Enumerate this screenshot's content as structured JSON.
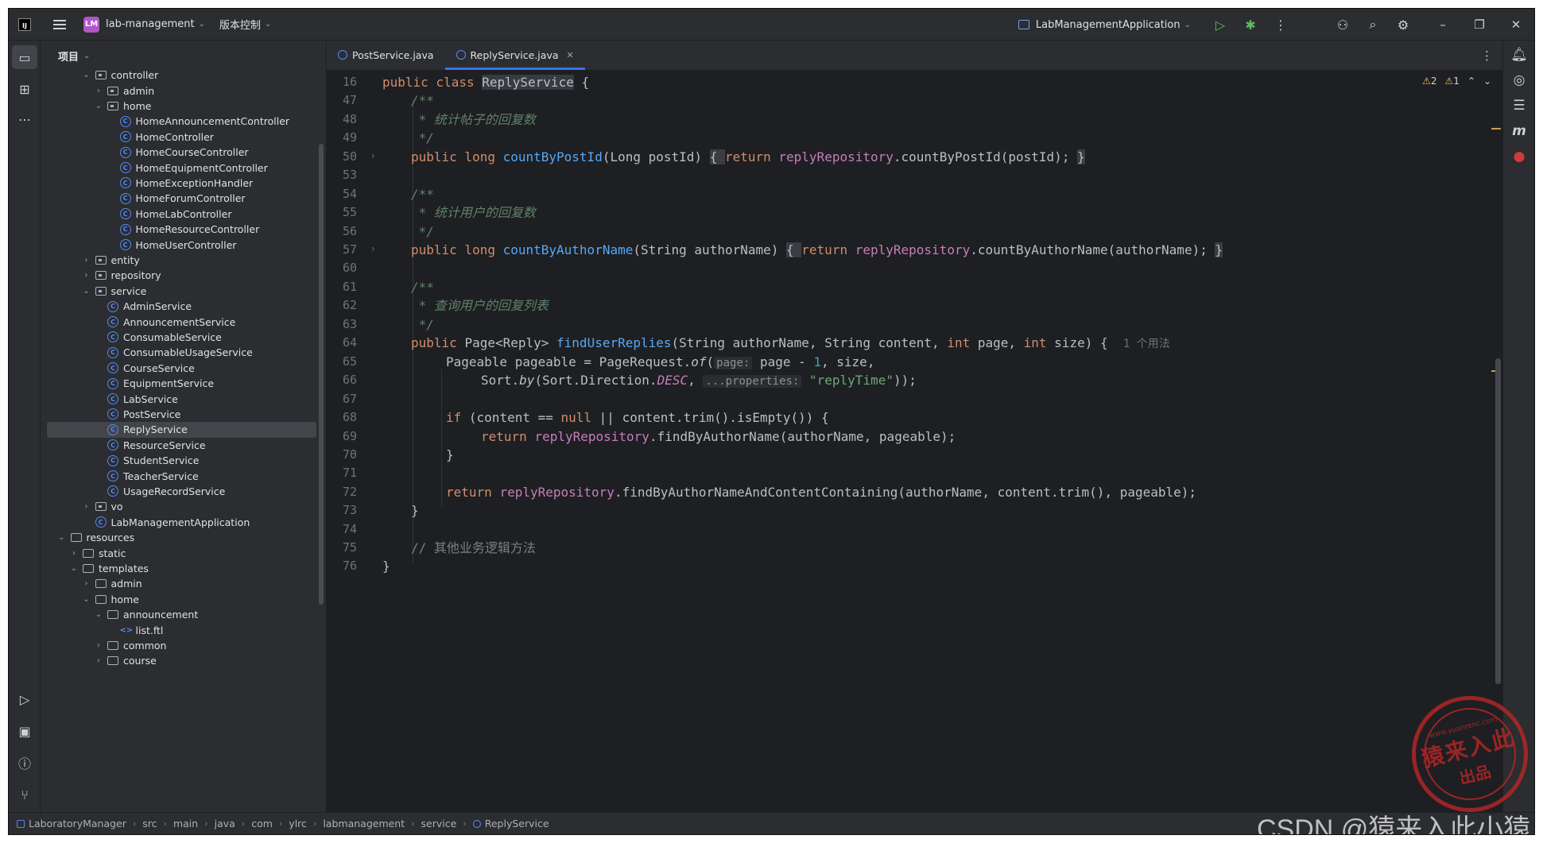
{
  "titlebar": {
    "logo": "IJ",
    "project_badge": "LM",
    "project_name": "lab-management",
    "vcs_label": "版本控制",
    "run_config": "LabManagementApplication"
  },
  "project_panel": {
    "title": "项目",
    "tree": [
      {
        "label": "controller",
        "type": "folder-pkg",
        "depth": 3,
        "expanded": true
      },
      {
        "label": "admin",
        "type": "folder-pkg",
        "depth": 4,
        "expanded": false
      },
      {
        "label": "home",
        "type": "folder-pkg",
        "depth": 4,
        "expanded": true
      },
      {
        "label": "HomeAnnouncementController",
        "type": "class",
        "depth": 5
      },
      {
        "label": "HomeController",
        "type": "class",
        "depth": 5
      },
      {
        "label": "HomeCourseController",
        "type": "class",
        "depth": 5
      },
      {
        "label": "HomeEquipmentController",
        "type": "class",
        "depth": 5
      },
      {
        "label": "HomeExceptionHandler",
        "type": "class",
        "depth": 5
      },
      {
        "label": "HomeForumController",
        "type": "class",
        "depth": 5
      },
      {
        "label": "HomeLabController",
        "type": "class",
        "depth": 5
      },
      {
        "label": "HomeResourceController",
        "type": "class",
        "depth": 5
      },
      {
        "label": "HomeUserController",
        "type": "class",
        "depth": 5
      },
      {
        "label": "entity",
        "type": "folder-pkg",
        "depth": 3,
        "expanded": false
      },
      {
        "label": "repository",
        "type": "folder-pkg",
        "depth": 3,
        "expanded": false
      },
      {
        "label": "service",
        "type": "folder-pkg",
        "depth": 3,
        "expanded": true
      },
      {
        "label": "AdminService",
        "type": "class",
        "depth": 4
      },
      {
        "label": "AnnouncementService",
        "type": "class",
        "depth": 4
      },
      {
        "label": "ConsumableService",
        "type": "class",
        "depth": 4
      },
      {
        "label": "ConsumableUsageService",
        "type": "class",
        "depth": 4
      },
      {
        "label": "CourseService",
        "type": "class",
        "depth": 4
      },
      {
        "label": "EquipmentService",
        "type": "class",
        "depth": 4
      },
      {
        "label": "LabService",
        "type": "class",
        "depth": 4
      },
      {
        "label": "PostService",
        "type": "class",
        "depth": 4
      },
      {
        "label": "ReplyService",
        "type": "class",
        "depth": 4,
        "selected": true
      },
      {
        "label": "ResourceService",
        "type": "class",
        "depth": 4
      },
      {
        "label": "StudentService",
        "type": "class",
        "depth": 4
      },
      {
        "label": "TeacherService",
        "type": "class",
        "depth": 4
      },
      {
        "label": "UsageRecordService",
        "type": "class",
        "depth": 4
      },
      {
        "label": "vo",
        "type": "folder-pkg",
        "depth": 3,
        "expanded": false
      },
      {
        "label": "LabManagementApplication",
        "type": "class",
        "depth": 3
      },
      {
        "label": "resources",
        "type": "folder",
        "depth": 1,
        "expanded": true
      },
      {
        "label": "static",
        "type": "folder",
        "depth": 2,
        "expanded": false
      },
      {
        "label": "templates",
        "type": "folder",
        "depth": 2,
        "expanded": true
      },
      {
        "label": "admin",
        "type": "folder",
        "depth": 3,
        "expanded": false
      },
      {
        "label": "home",
        "type": "folder",
        "depth": 3,
        "expanded": true
      },
      {
        "label": "announcement",
        "type": "folder",
        "depth": 4,
        "expanded": true
      },
      {
        "label": "list.ftl",
        "type": "ftl",
        "depth": 5
      },
      {
        "label": "common",
        "type": "folder",
        "depth": 4,
        "expanded": false
      },
      {
        "label": "course",
        "type": "folder",
        "depth": 4,
        "expanded": false
      }
    ]
  },
  "tabs": [
    {
      "label": "PostService.java",
      "active": false
    },
    {
      "label": "ReplyService.java",
      "active": true
    }
  ],
  "inspections": {
    "warnings": "2",
    "weak_warnings": "1"
  },
  "line_numbers": [
    "16",
    "47",
    "48",
    "49",
    "50",
    "53",
    "54",
    "55",
    "56",
    "57",
    "60",
    "61",
    "62",
    "63",
    "64",
    "65",
    "66",
    "67",
    "68",
    "69",
    "70",
    "71",
    "72",
    "73",
    "74",
    "75",
    "76"
  ],
  "code": {
    "l16_a": "public class ",
    "l16_b": "ReplyService",
    "l16_c": " {",
    "l47": "/**",
    "l48": " * 统计帖子的回复数",
    "l49": " */",
    "l50_a": "public long ",
    "l50_b": "countByPostId",
    "l50_c": "(Long postId) ",
    "l50_d": "{ ",
    "l50_e": "return ",
    "l50_f": "replyRepository",
    "l50_g": ".countByPostId(postId); ",
    "l50_h": "}",
    "l53": "",
    "l54": "/**",
    "l55": " * 统计用户的回复数",
    "l56": " */",
    "l57_a": "public long ",
    "l57_b": "countByAuthorName",
    "l57_c": "(String authorName) ",
    "l57_d": "{ ",
    "l57_e": "return ",
    "l57_f": "replyRepository",
    "l57_g": ".countByAuthorName(authorName); ",
    "l57_h": "}",
    "l61": "/**",
    "l62": " * 查询用户的回复列表",
    "l63": " */",
    "l64_a": "public ",
    "l64_b": "Page<Reply> ",
    "l64_c": "findUserReplies",
    "l64_d": "(String authorName, String content, ",
    "l64_e": "int ",
    "l64_f": "page, ",
    "l64_g": "int ",
    "l64_h": "size) {",
    "l64_usage": "1 个用法",
    "l65_a": "Pageable pageable = PageRequest.",
    "l65_b": "of",
    "l65_c": "(",
    "l65_hint": "page:",
    "l65_d": " page - ",
    "l65_e": "1",
    "l65_f": ", size,",
    "l66_a": "Sort.",
    "l66_b": "by",
    "l66_c": "(Sort.Direction.",
    "l66_d": "DESC",
    "l66_e": ", ",
    "l66_hint": "...properties:",
    "l66_f": " \"replyTime\"",
    "l66_g": "));",
    "l68_a": "if ",
    "l68_b": "(content == ",
    "l68_c": "null ",
    "l68_d": "|| content.trim().isEmpty()) {",
    "l69_a": "return ",
    "l69_b": "replyRepository",
    "l69_c": ".findByAuthorName(authorName, pageable);",
    "l70": "}",
    "l72_a": "return ",
    "l72_b": "replyRepository",
    "l72_c": ".findByAuthorNameAndContentContaining(authorName, content.trim(), pageable);",
    "l73": "}",
    "l75": "// 其他业务逻辑方法",
    "l76": "}"
  },
  "statusbar": {
    "crumbs": [
      "LaboratoryManager",
      "src",
      "main",
      "java",
      "com",
      "ylrc",
      "labmanagement",
      "service",
      "ReplyService"
    ]
  },
  "watermark": {
    "seal_url": "www.yuanrenc.com",
    "seal_main": "猿来入此",
    "seal_sub": "出品",
    "csdn": "CSDN @猿来入此小猿"
  }
}
